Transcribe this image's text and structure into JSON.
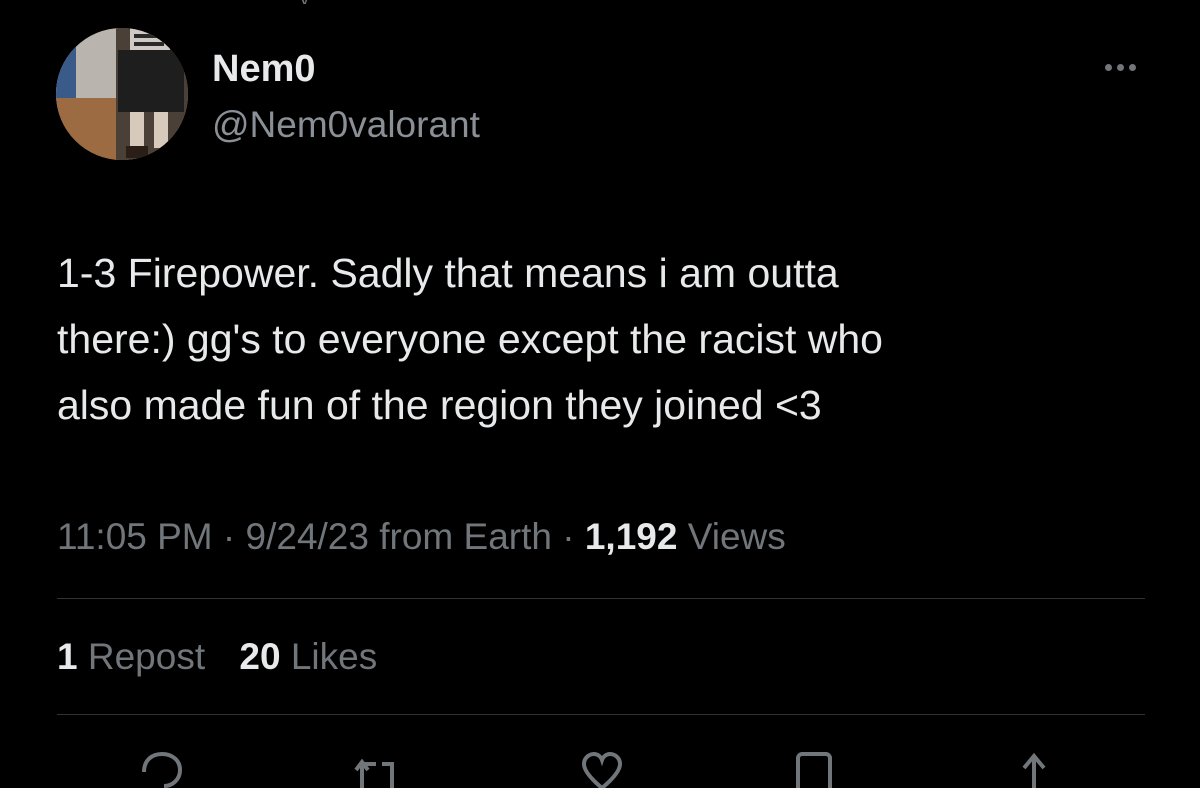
{
  "tweet": {
    "author": {
      "display_name": "Nem0",
      "handle": "@Nem0valorant",
      "avatar": "avatar-photo"
    },
    "text_lines": [
      "1-3 Firepower. Sadly that means i am outta",
      "there:) gg's to everyone except the racist who",
      "also made fun of the region they joined <3"
    ],
    "meta": {
      "time": "11:05 PM",
      "separator": "·",
      "date": "9/24/23",
      "from_text": "from Earth",
      "views_count": "1,192",
      "views_label": "Views"
    },
    "stats": {
      "reposts_count": "1",
      "reposts_label": "Repost",
      "likes_count": "20",
      "likes_label": "Likes"
    }
  },
  "icons": {
    "more": "more-horizontal-icon",
    "reply": "reply-icon",
    "repost": "repost-icon",
    "like": "heart-icon",
    "bookmark": "bookmark-icon",
    "share": "share-icon"
  },
  "colors": {
    "background": "#000000",
    "text_primary": "#e7e9ea",
    "text_secondary": "#71767b",
    "divider": "#2f3336"
  }
}
